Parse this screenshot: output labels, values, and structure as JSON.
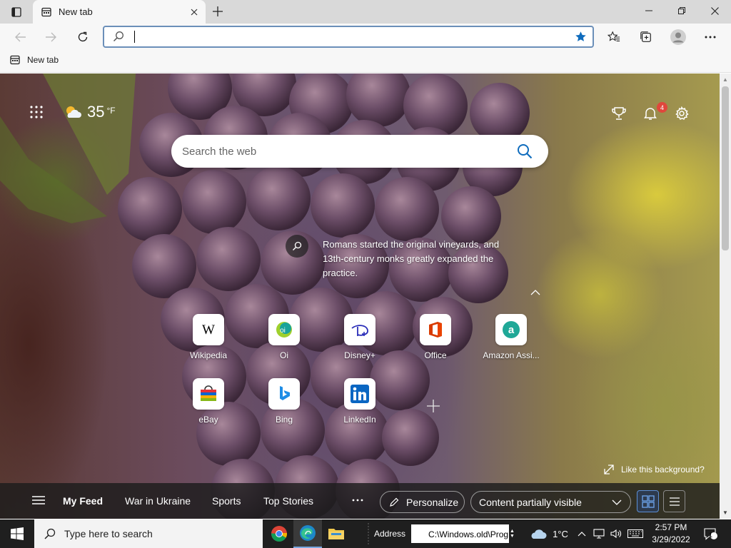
{
  "browser": {
    "tab_title": "New tab",
    "address_value": "",
    "favorites": [
      {
        "label": "New tab"
      }
    ]
  },
  "ntp": {
    "weather": {
      "temp": "35",
      "unit": "°F",
      "icon": "partly-cloudy-icon"
    },
    "notification_count": "4",
    "search_placeholder": "Search the web",
    "fact_text": "Romans started the original vineyards, and 13th-century monks greatly expanded the practice.",
    "quick_links": [
      {
        "label": "Wikipedia",
        "icon": "wikipedia-icon"
      },
      {
        "label": "Oi",
        "icon": "oi-icon"
      },
      {
        "label": "Disney+",
        "icon": "disney-plus-icon"
      },
      {
        "label": "Office",
        "icon": "office-icon"
      },
      {
        "label": "Amazon Assi...",
        "icon": "amazon-assistant-icon"
      },
      {
        "label": "eBay",
        "icon": "ebay-icon"
      },
      {
        "label": "Bing",
        "icon": "bing-icon"
      },
      {
        "label": "LinkedIn",
        "icon": "linkedin-icon"
      }
    ],
    "like_background": "Like this background?",
    "feed_tabs": [
      "My Feed",
      "War in Ukraine",
      "Sports",
      "Top Stories"
    ],
    "personalize_label": "Personalize",
    "content_visibility": "Content partially visible"
  },
  "taskbar": {
    "search_placeholder": "Type here to search",
    "address_label": "Address",
    "address_value": "C:\\Windows.old\\Prog",
    "weather_temp": "1°C",
    "time": "2:57 PM",
    "date": "3/29/2022",
    "notification_count": "1"
  },
  "colors": {
    "accent": "#0f6cbd",
    "address_border": "#6b8fb9",
    "badge": "#e0473c"
  }
}
